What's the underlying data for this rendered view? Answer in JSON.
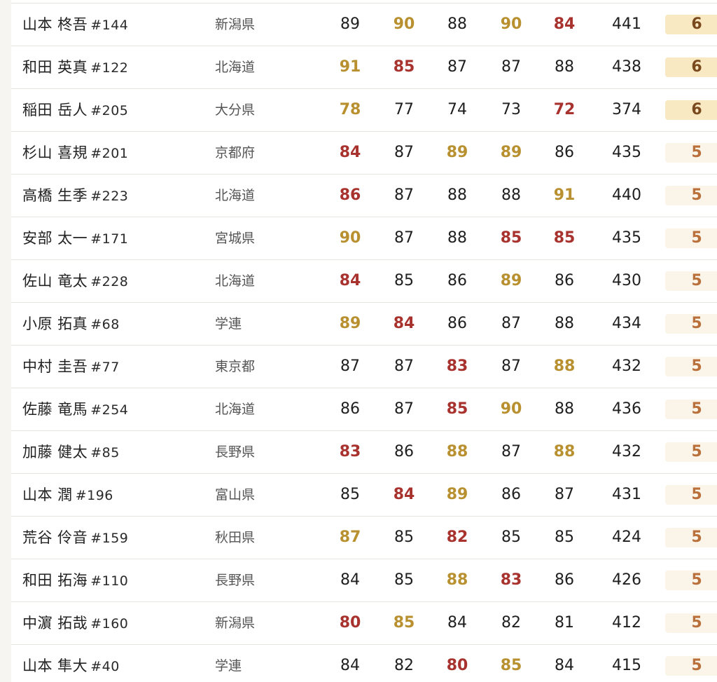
{
  "rows": [
    {
      "name": "山本 柊吾",
      "no": "#144",
      "pref": "新潟県",
      "scores": [
        {
          "v": "89",
          "c": ""
        },
        {
          "v": "90",
          "c": "g"
        },
        {
          "v": "88",
          "c": ""
        },
        {
          "v": "90",
          "c": "g"
        },
        {
          "v": "84",
          "c": "r"
        }
      ],
      "total": "441",
      "rank": "6",
      "hi": true
    },
    {
      "name": "和田 英真",
      "no": "#122",
      "pref": "北海道",
      "scores": [
        {
          "v": "91",
          "c": "g"
        },
        {
          "v": "85",
          "c": "r"
        },
        {
          "v": "87",
          "c": ""
        },
        {
          "v": "87",
          "c": ""
        },
        {
          "v": "88",
          "c": ""
        }
      ],
      "total": "438",
      "rank": "6",
      "hi": true
    },
    {
      "name": "稲田 岳人",
      "no": "#205",
      "pref": "大分県",
      "scores": [
        {
          "v": "78",
          "c": "g"
        },
        {
          "v": "77",
          "c": ""
        },
        {
          "v": "74",
          "c": ""
        },
        {
          "v": "73",
          "c": ""
        },
        {
          "v": "72",
          "c": "r"
        }
      ],
      "total": "374",
      "rank": "6",
      "hi": true
    },
    {
      "name": "杉山 喜規",
      "no": "#201",
      "pref": "京都府",
      "scores": [
        {
          "v": "84",
          "c": "r"
        },
        {
          "v": "87",
          "c": ""
        },
        {
          "v": "89",
          "c": "g"
        },
        {
          "v": "89",
          "c": "g"
        },
        {
          "v": "86",
          "c": ""
        }
      ],
      "total": "435",
      "rank": "5",
      "hi": false
    },
    {
      "name": "高橋 生季",
      "no": "#223",
      "pref": "北海道",
      "scores": [
        {
          "v": "86",
          "c": "r"
        },
        {
          "v": "87",
          "c": ""
        },
        {
          "v": "88",
          "c": ""
        },
        {
          "v": "88",
          "c": ""
        },
        {
          "v": "91",
          "c": "g"
        }
      ],
      "total": "440",
      "rank": "5",
      "hi": false
    },
    {
      "name": "安部 太一",
      "no": "#171",
      "pref": "宮城県",
      "scores": [
        {
          "v": "90",
          "c": "g"
        },
        {
          "v": "87",
          "c": ""
        },
        {
          "v": "88",
          "c": ""
        },
        {
          "v": "85",
          "c": "r"
        },
        {
          "v": "85",
          "c": "r"
        }
      ],
      "total": "435",
      "rank": "5",
      "hi": false
    },
    {
      "name": "佐山 竜太",
      "no": "#228",
      "pref": "北海道",
      "scores": [
        {
          "v": "84",
          "c": "r"
        },
        {
          "v": "85",
          "c": ""
        },
        {
          "v": "86",
          "c": ""
        },
        {
          "v": "89",
          "c": "g"
        },
        {
          "v": "86",
          "c": ""
        }
      ],
      "total": "430",
      "rank": "5",
      "hi": false
    },
    {
      "name": "小原 拓真",
      "no": "#68",
      "pref": "学連",
      "scores": [
        {
          "v": "89",
          "c": "g"
        },
        {
          "v": "84",
          "c": "r"
        },
        {
          "v": "86",
          "c": ""
        },
        {
          "v": "87",
          "c": ""
        },
        {
          "v": "88",
          "c": ""
        }
      ],
      "total": "434",
      "rank": "5",
      "hi": false
    },
    {
      "name": "中村 圭吾",
      "no": "#77",
      "pref": "東京都",
      "scores": [
        {
          "v": "87",
          "c": ""
        },
        {
          "v": "87",
          "c": ""
        },
        {
          "v": "83",
          "c": "r"
        },
        {
          "v": "87",
          "c": ""
        },
        {
          "v": "88",
          "c": "g"
        }
      ],
      "total": "432",
      "rank": "5",
      "hi": false
    },
    {
      "name": "佐藤 竜馬",
      "no": "#254",
      "pref": "北海道",
      "scores": [
        {
          "v": "86",
          "c": ""
        },
        {
          "v": "87",
          "c": ""
        },
        {
          "v": "85",
          "c": "r"
        },
        {
          "v": "90",
          "c": "g"
        },
        {
          "v": "88",
          "c": ""
        }
      ],
      "total": "436",
      "rank": "5",
      "hi": false
    },
    {
      "name": "加藤 健太",
      "no": "#85",
      "pref": "長野県",
      "scores": [
        {
          "v": "83",
          "c": "r"
        },
        {
          "v": "86",
          "c": ""
        },
        {
          "v": "88",
          "c": "g"
        },
        {
          "v": "87",
          "c": ""
        },
        {
          "v": "88",
          "c": "g"
        }
      ],
      "total": "432",
      "rank": "5",
      "hi": false
    },
    {
      "name": "山本 潤",
      "no": "#196",
      "pref": "富山県",
      "scores": [
        {
          "v": "85",
          "c": ""
        },
        {
          "v": "84",
          "c": "r"
        },
        {
          "v": "89",
          "c": "g"
        },
        {
          "v": "86",
          "c": ""
        },
        {
          "v": "87",
          "c": ""
        }
      ],
      "total": "431",
      "rank": "5",
      "hi": false
    },
    {
      "name": "荒谷 伶音",
      "no": "#159",
      "pref": "秋田県",
      "scores": [
        {
          "v": "87",
          "c": "g"
        },
        {
          "v": "85",
          "c": ""
        },
        {
          "v": "82",
          "c": "r"
        },
        {
          "v": "85",
          "c": ""
        },
        {
          "v": "85",
          "c": ""
        }
      ],
      "total": "424",
      "rank": "5",
      "hi": false
    },
    {
      "name": "和田 拓海",
      "no": "#110",
      "pref": "長野県",
      "scores": [
        {
          "v": "84",
          "c": ""
        },
        {
          "v": "85",
          "c": ""
        },
        {
          "v": "88",
          "c": "g"
        },
        {
          "v": "83",
          "c": "r"
        },
        {
          "v": "86",
          "c": ""
        }
      ],
      "total": "426",
      "rank": "5",
      "hi": false
    },
    {
      "name": "中濵 拓哉",
      "no": "#160",
      "pref": "新潟県",
      "scores": [
        {
          "v": "80",
          "c": "r"
        },
        {
          "v": "85",
          "c": "g"
        },
        {
          "v": "84",
          "c": ""
        },
        {
          "v": "82",
          "c": ""
        },
        {
          "v": "81",
          "c": ""
        }
      ],
      "total": "412",
      "rank": "5",
      "hi": false
    },
    {
      "name": "山本 隼大",
      "no": "#40",
      "pref": "学連",
      "scores": [
        {
          "v": "84",
          "c": ""
        },
        {
          "v": "82",
          "c": ""
        },
        {
          "v": "80",
          "c": "r"
        },
        {
          "v": "85",
          "c": "g"
        },
        {
          "v": "84",
          "c": ""
        }
      ],
      "total": "415",
      "rank": "5",
      "hi": false
    }
  ]
}
